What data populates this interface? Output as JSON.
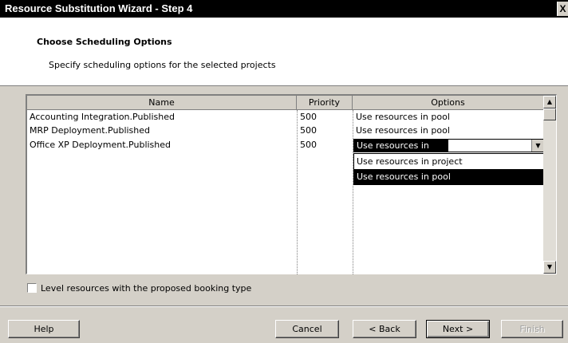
{
  "window": {
    "title": "Resource Substitution Wizard - Step 4",
    "close_glyph": "X"
  },
  "header": {
    "heading": "Choose Scheduling Options",
    "subtitle": "Specify scheduling options for the selected projects"
  },
  "grid": {
    "columns": [
      "Name",
      "Priority",
      "Options"
    ],
    "rows": [
      {
        "name": "Accounting Integration.Published",
        "priority": "500",
        "options": "Use resources in pool"
      },
      {
        "name": "MRP Deployment.Published",
        "priority": "500",
        "options": "Use resources in pool"
      },
      {
        "name": "Office XP Deployment.Published",
        "priority": "500",
        "options": "Use resources in pool"
      }
    ],
    "dropdown_options": [
      "Use resources in project",
      "Use resources in pool"
    ]
  },
  "checkbox": {
    "label": "Level resources with the proposed booking type",
    "checked": false
  },
  "buttons": {
    "help": "Help",
    "cancel": "Cancel",
    "back": "< Back",
    "next": "Next >",
    "finish": "Finish"
  }
}
